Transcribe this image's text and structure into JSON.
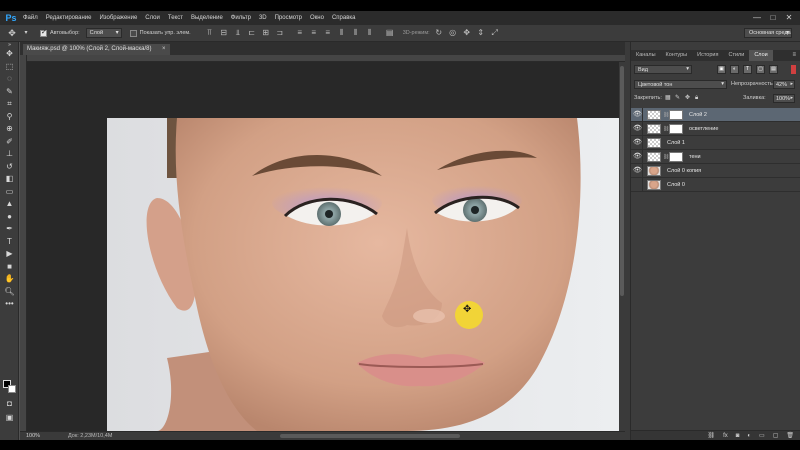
{
  "app": {
    "logo": "Ps"
  },
  "menu": [
    "Файл",
    "Редактирование",
    "Изображение",
    "Слои",
    "Текст",
    "Выделение",
    "Фильтр",
    "3D",
    "Просмотр",
    "Окно",
    "Справка"
  ],
  "window_controls": [
    "—",
    "□",
    "✕"
  ],
  "options": {
    "autoselect_label": "Автовыбор:",
    "autoselect_value": "Слой",
    "show_controls_label": "Показать упр. элем.",
    "mode_3d_label": "3D-режим:",
    "workspace": "Основная среда"
  },
  "document": {
    "tab_title": "Макияж.psd @ 100% (Слой 2, Слой-маска/8)",
    "close": "×",
    "zoom": "100%",
    "info": "Док: 2,23M/10,4M"
  },
  "panel": {
    "tabs": [
      "Каналы",
      "Контуры",
      "История",
      "Стили",
      "Слои"
    ],
    "active_tab": "Слои",
    "menu_icon": "≡",
    "filter_kind": "Вид",
    "blend_mode": "Цветовой тон",
    "opacity_label": "Непрозрачность:",
    "opacity_value": "42%",
    "lock_label": "Закрепить:",
    "fill_label": "Заливка:",
    "fill_value": "100%",
    "layers": [
      {
        "name": "Слой 2",
        "visible": true,
        "selected": true,
        "thumb": "checker",
        "mask": true
      },
      {
        "name": "осветление",
        "visible": true,
        "selected": false,
        "thumb": "checker",
        "mask": true
      },
      {
        "name": "Слой 1",
        "visible": true,
        "selected": false,
        "thumb": "checker",
        "mask": false
      },
      {
        "name": "тени",
        "visible": true,
        "selected": false,
        "thumb": "checker",
        "mask": true
      },
      {
        "name": "Слой 0 копия",
        "visible": true,
        "selected": false,
        "thumb": "face",
        "mask": false
      },
      {
        "name": "Слой 0",
        "visible": false,
        "selected": false,
        "thumb": "face",
        "mask": false
      }
    ],
    "footer_icons": [
      "link-icon",
      "fx-icon",
      "mask-icon",
      "adjustment-icon",
      "folder-icon",
      "new-layer-icon",
      "trash-icon"
    ]
  },
  "colors": {
    "skin": "#d7a88f",
    "eyeshadow": "#a98ac2",
    "lips": "#d98f8a",
    "background": "#e7e8ea",
    "cursor_highlight": "#f6dc28"
  }
}
